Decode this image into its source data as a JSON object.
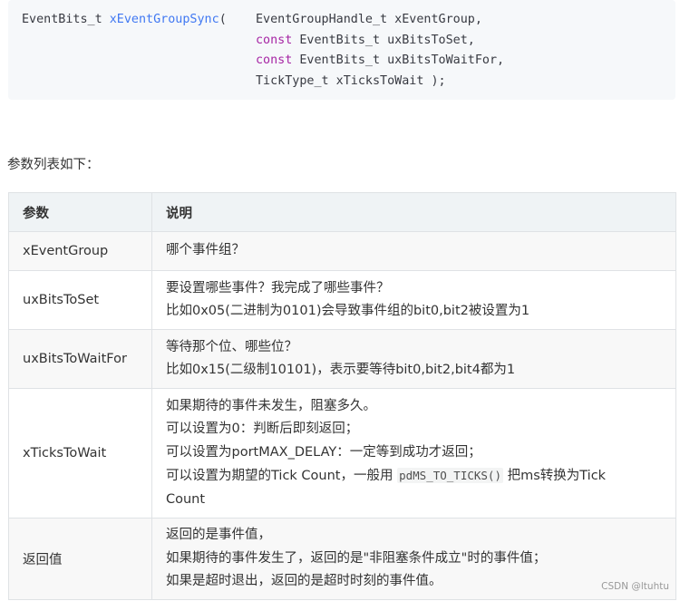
{
  "code": {
    "lines": [
      [
        {
          "t": "EventBits_t ",
          "c": "plain"
        },
        {
          "t": "xEventGroupSync",
          "c": "fn"
        },
        {
          "t": "(    EventGroupHandle_t xEventGroup,",
          "c": "plain"
        }
      ],
      [
        {
          "t": "                                const ",
          "c": "kw"
        },
        {
          "t": "EventBits_t uxBitsToSet,",
          "c": "plain"
        }
      ],
      [
        {
          "t": "                                const ",
          "c": "kw"
        },
        {
          "t": "EventBits_t uxBitsToWaitFor,",
          "c": "plain"
        }
      ],
      [
        {
          "t": "                                TickType_t xTicksToWait );",
          "c": "plain"
        }
      ]
    ]
  },
  "intro_text": "参数列表如下：",
  "table": {
    "headers": [
      "参数",
      "说明"
    ],
    "rows": [
      {
        "name": "xEventGroup",
        "desc": [
          "哪个事件组？"
        ]
      },
      {
        "name": "uxBitsToSet",
        "desc": [
          "要设置哪些事件？我完成了哪些事件？",
          "比如0x05(二进制为0101)会导致事件组的bit0,bit2被设置为1"
        ]
      },
      {
        "name": "uxBitsToWaitFor",
        "desc": [
          "等待那个位、哪些位？",
          "比如0x15(二级制10101)，表示要等待bit0,bit2,bit4都为1"
        ]
      },
      {
        "name": "xTicksToWait",
        "desc": [
          "如果期待的事件未发生，阻塞多久。",
          "可以设置为0：判断后即刻返回；",
          "可以设置为portMAX_DELAY：一定等到成功才返回；",
          "可以设置为期望的Tick Count，一般用 |pdMS_TO_TICKS()| 把ms转换为Tick",
          "Count"
        ]
      },
      {
        "name": "返回值",
        "desc": [
          "返回的是事件值，",
          "如果期待的事件发生了，返回的是\"非阻塞条件成立\"时的事件值；",
          "如果是超时退出，返回的是超时时刻的事件值。"
        ]
      }
    ]
  },
  "watermark": "CSDN @ltuhtu"
}
